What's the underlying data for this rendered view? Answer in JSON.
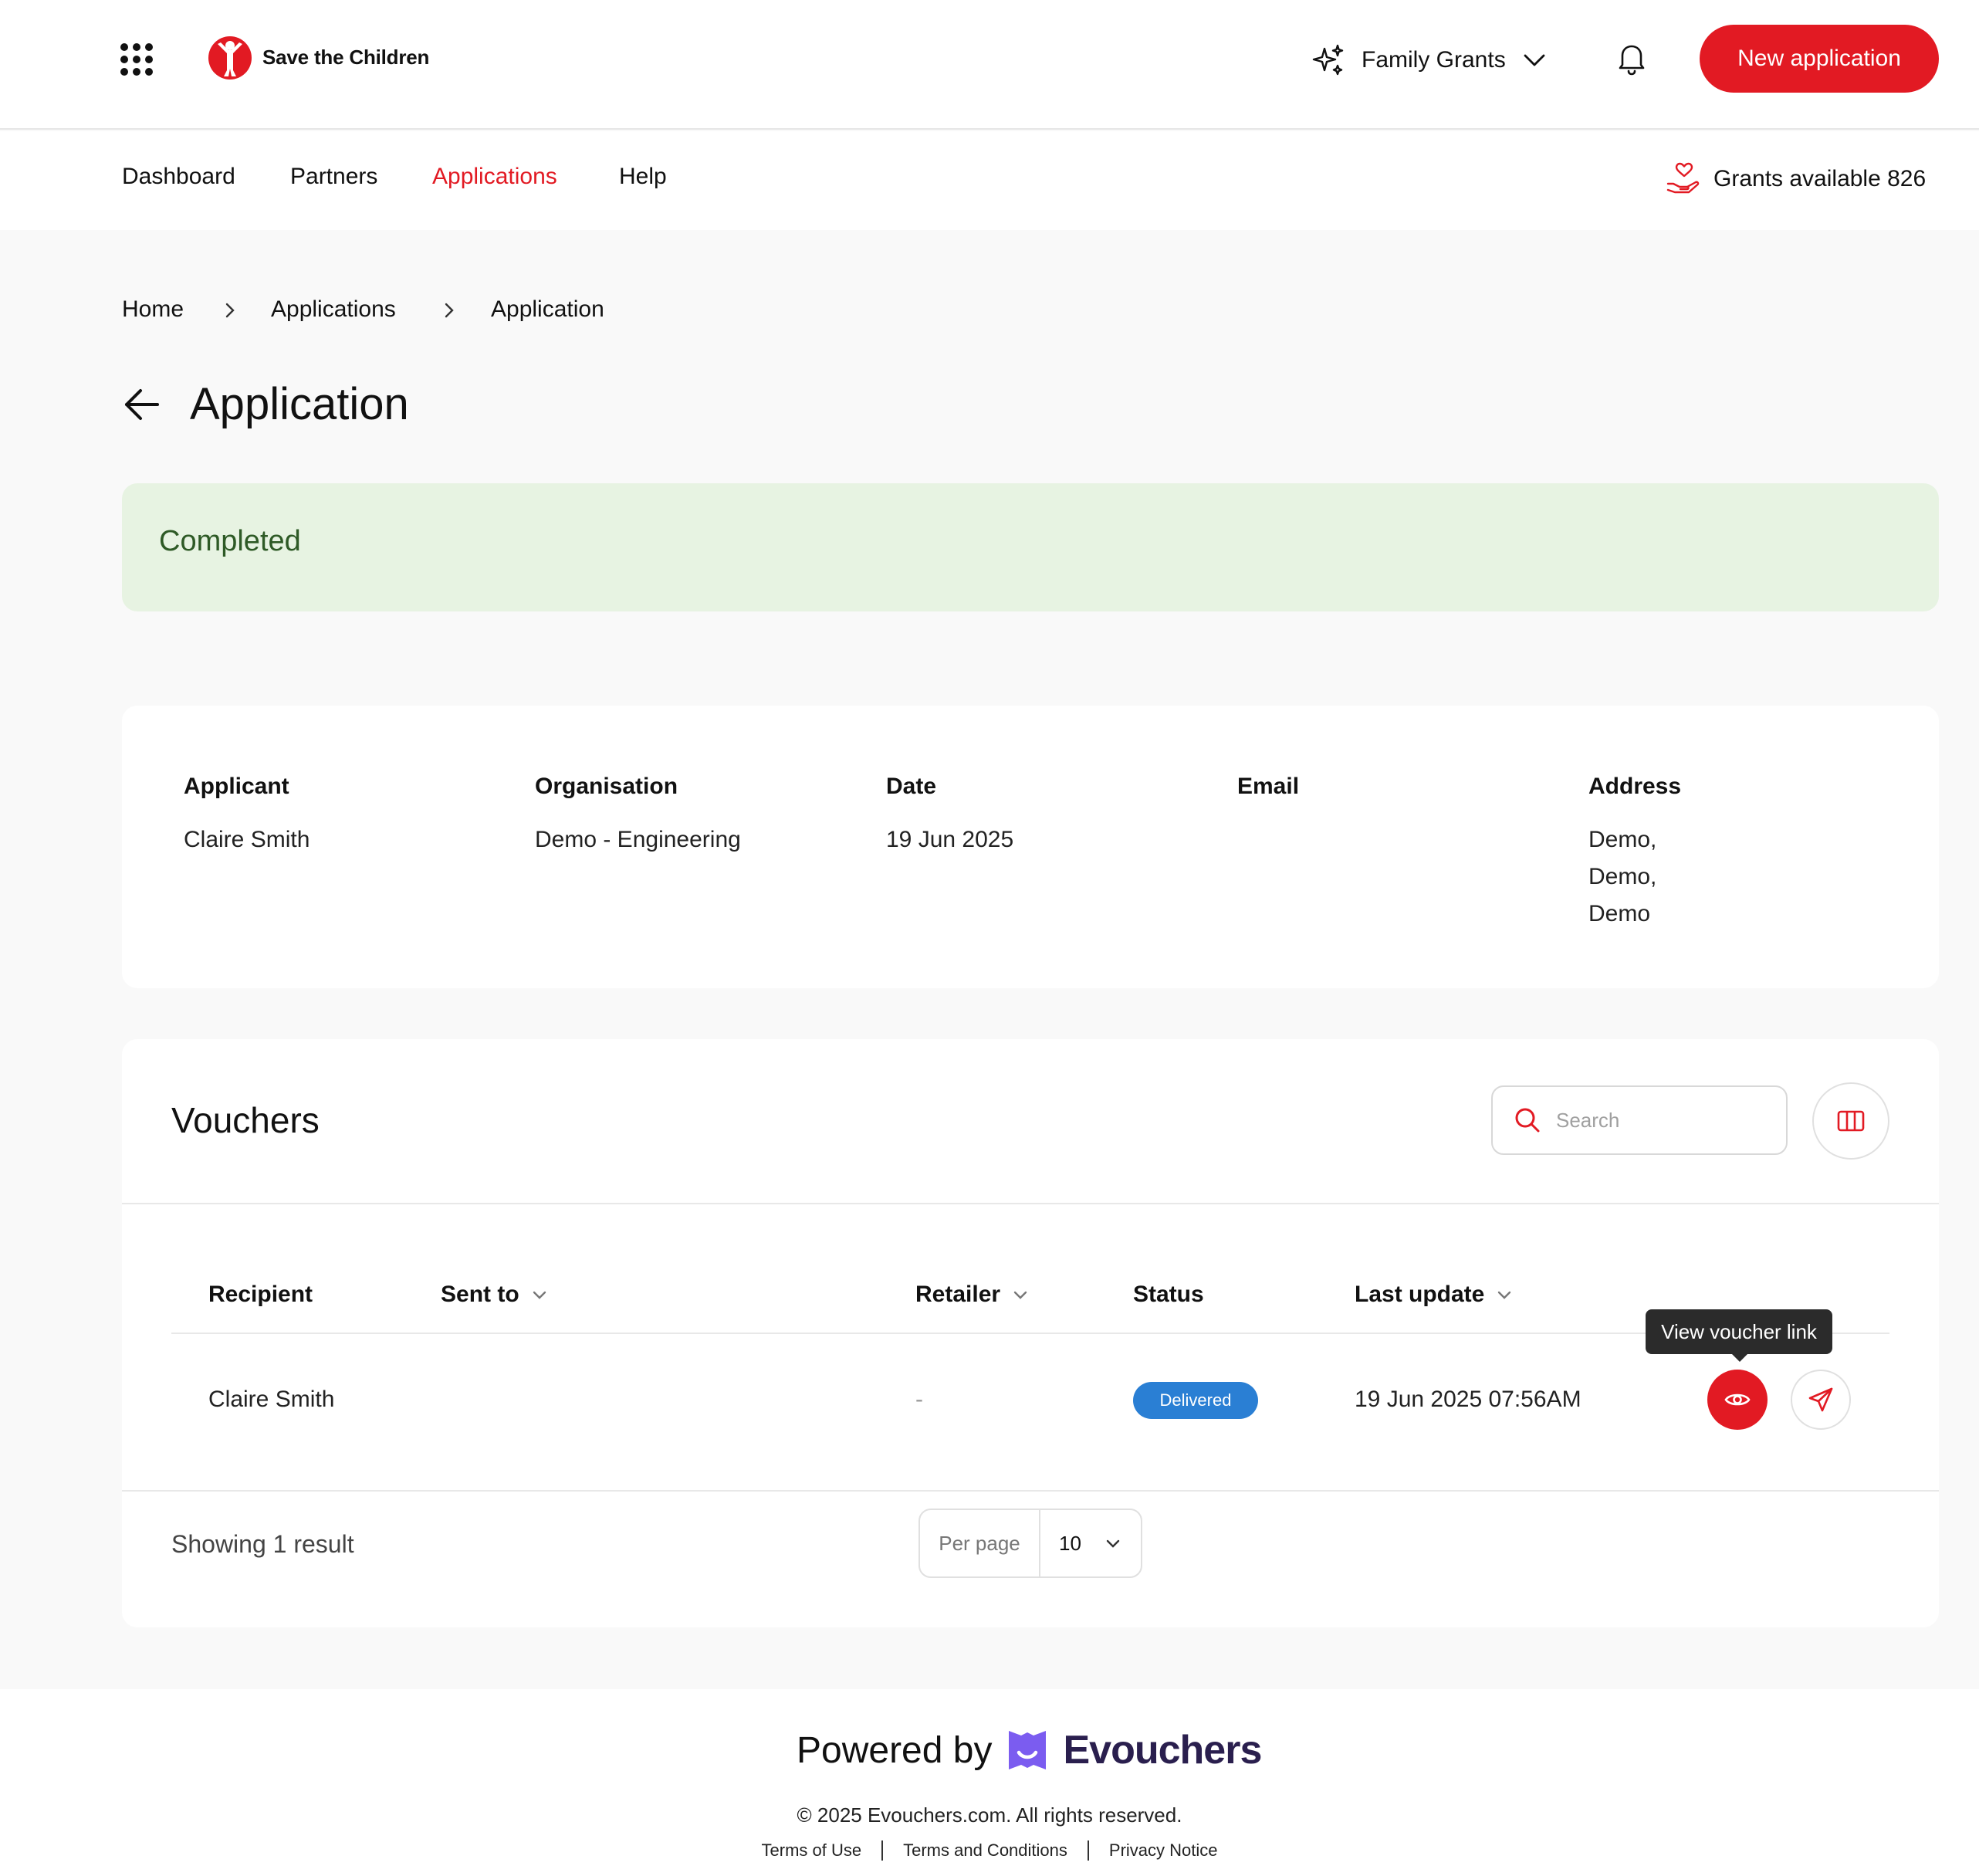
{
  "header": {
    "brand": "Save the Children",
    "program": "Family Grants",
    "new_application": "New application"
  },
  "nav": {
    "items": [
      "Dashboard",
      "Partners",
      "Applications",
      "Help"
    ],
    "active": "Applications",
    "grants_available": "Grants available 826"
  },
  "breadcrumb": [
    "Home",
    "Applications",
    "Application"
  ],
  "page": {
    "title": "Application",
    "status": "Completed"
  },
  "applicant_info": {
    "labels": [
      "Applicant",
      "Organisation",
      "Date",
      "Email",
      "Address"
    ],
    "applicant": "Claire Smith",
    "organisation": "Demo - Engineering",
    "date": "19 Jun 2025",
    "email": "",
    "address": [
      "Demo,",
      "Demo,",
      "Demo"
    ]
  },
  "vouchers": {
    "title": "Vouchers",
    "search_placeholder": "Search",
    "columns": [
      "Recipient",
      "Sent to",
      "Retailer",
      "Status",
      "Last update"
    ],
    "rows": [
      {
        "recipient": "Claire Smith",
        "sent_to": "",
        "retailer": "-",
        "status": "Delivered",
        "last_update": "19 Jun 2025 07:56AM"
      }
    ],
    "tooltip": "View voucher link",
    "showing": "Showing 1 result",
    "per_page_label": "Per page",
    "per_page_value": "10"
  },
  "footer": {
    "powered_by": "Powered by",
    "provider": "Evouchers",
    "copyright": "© 2025 Evouchers.com. All rights reserved.",
    "links": [
      "Terms of Use",
      "Terms and Conditions",
      "Privacy Notice"
    ]
  },
  "colors": {
    "brand_red": "#e21a23",
    "status_bg": "#e7f3e2",
    "status_text": "#2e5a26",
    "badge_blue": "#2a7fd4",
    "evouchers_purple": "#7b5cf0"
  }
}
